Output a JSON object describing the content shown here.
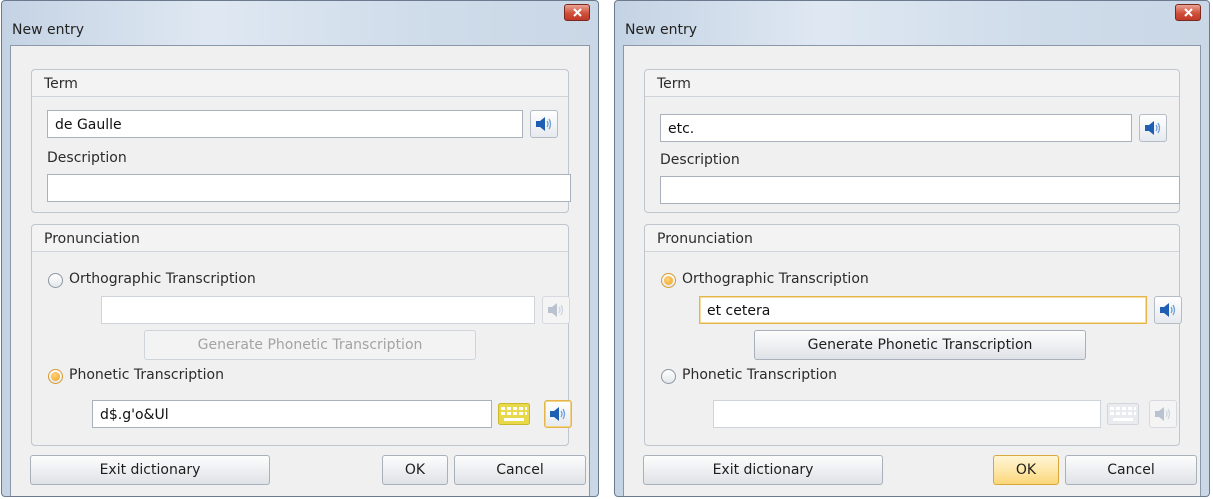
{
  "dialogs": [
    {
      "title": "New entry",
      "term_group": "Term",
      "term_value": "de Gaulle",
      "description_label": "Description",
      "description_value": "",
      "pronunciation_group": "Pronunciation",
      "ortho_label": "Orthographic Transcription",
      "ortho_value": "",
      "generate_button": "Generate Phonetic Transcription",
      "phonetic_label": "Phonetic Transcription",
      "phonetic_value": "d$.g'o&Ul",
      "selected_mode": "phonetic",
      "exit_button": "Exit dictionary",
      "ok_button": "OK",
      "cancel_button": "Cancel"
    },
    {
      "title": "New entry",
      "term_group": "Term",
      "term_value": "etc.",
      "description_label": "Description",
      "description_value": "",
      "pronunciation_group": "Pronunciation",
      "ortho_label": "Orthographic Transcription",
      "ortho_value": "et cetera",
      "generate_button": "Generate Phonetic Transcription",
      "phonetic_label": "Phonetic Transcription",
      "phonetic_value": "",
      "selected_mode": "orthographic",
      "exit_button": "Exit dictionary",
      "ok_button": "OK",
      "cancel_button": "Cancel"
    }
  ],
  "icons": {
    "speaker": "speaker-icon",
    "keyboard": "keyboard-icon",
    "close": "close-icon"
  },
  "colors": {
    "focus_border": "#e3b54a",
    "speaker_blue": "#1f5fb3",
    "keyboard_active": "#e8d84a",
    "close_red": "#c0392b"
  }
}
